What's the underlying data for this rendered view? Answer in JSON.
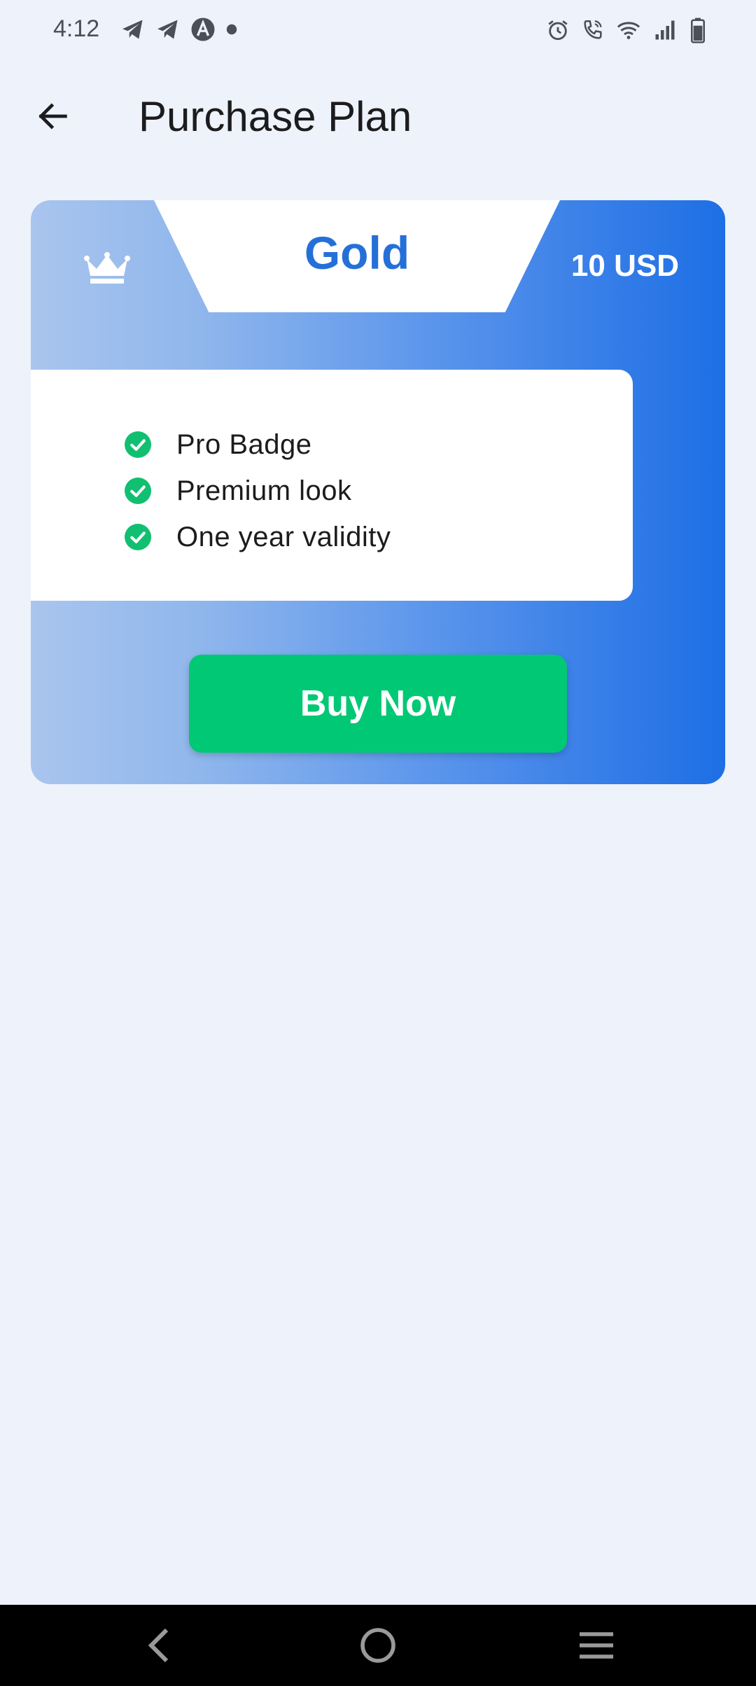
{
  "status_bar": {
    "time": "4:12",
    "left_icons": [
      "telegram-icon",
      "telegram-icon",
      "app-a-icon",
      "dot-icon"
    ],
    "right_icons": [
      "alarm-icon",
      "wifi-call-icon",
      "wifi-icon",
      "signal-icon",
      "battery-icon"
    ]
  },
  "app_bar": {
    "back_icon": "arrow-left-icon",
    "title": "Purchase Plan"
  },
  "plan": {
    "name": "Gold",
    "price": "10 USD",
    "icon": "crown-icon",
    "features": [
      {
        "label": "Pro Badge",
        "icon": "check-circle-icon"
      },
      {
        "label": "Premium look",
        "icon": "check-circle-icon"
      },
      {
        "label": "One year validity",
        "icon": "check-circle-icon"
      }
    ],
    "buy_label": "Buy Now"
  },
  "nav_bar": {
    "icons": [
      "nav-back-icon",
      "nav-home-icon",
      "nav-menu-icon"
    ]
  },
  "colors": {
    "background": "#eef2fa",
    "accent_blue": "#2470d8",
    "gradient_start": "#a9c5ee",
    "gradient_end": "#1d6fe5",
    "buy_green": "#00c874",
    "check_green": "#10c070"
  }
}
